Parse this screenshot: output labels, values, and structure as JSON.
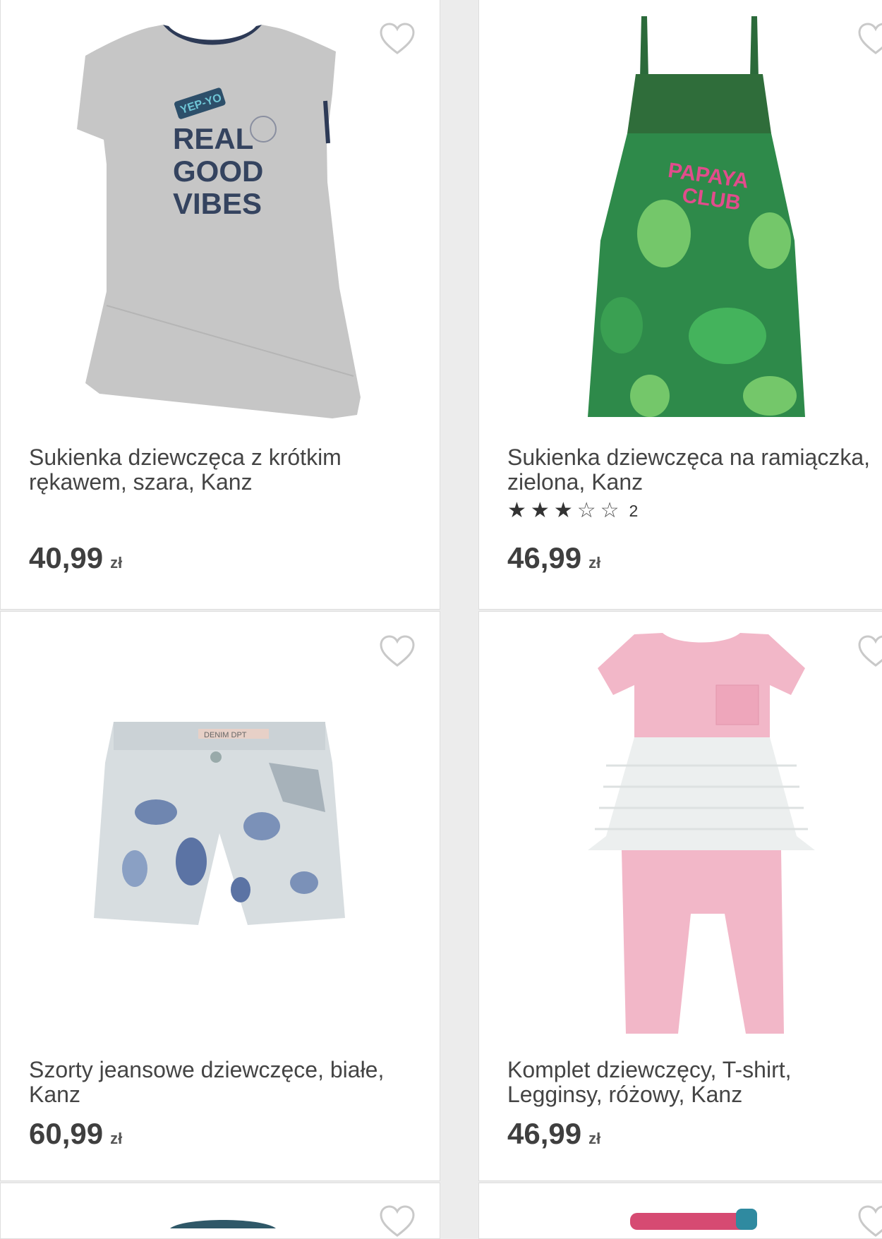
{
  "colors": {
    "page_bg": "#ececec",
    "card_bg": "#ffffff",
    "text": "#444444"
  },
  "products": [
    {
      "title": "Sukienka dziewczęca z krótkim rękawem, szara, Kanz",
      "price": "40,99",
      "currency": "zł",
      "image_print": [
        "YEP-YO",
        "REAL",
        "GOOD",
        "VIBES"
      ],
      "favorite_icon": "heart-outline-icon"
    },
    {
      "title": "Sukienka dziewczęca na ramiączka, zielona, Kanz",
      "price": "46,99",
      "currency": "zł",
      "rating": {
        "stars": 3,
        "max": 5,
        "count": "2"
      },
      "image_print": [
        "PAPAYA",
        "CLUB"
      ],
      "favorite_icon": "heart-outline-icon"
    },
    {
      "title": "Szorty jeansowe dziewczęce, białe, Kanz",
      "price": "60,99",
      "currency": "zł",
      "image_print": [
        "DENIM DPT"
      ],
      "favorite_icon": "heart-outline-icon"
    },
    {
      "title": "Komplet dziewczęcy, T-shirt, Legginsy, różowy, Kanz",
      "price": "46,99",
      "currency": "zł",
      "favorite_icon": "heart-outline-icon"
    }
  ]
}
